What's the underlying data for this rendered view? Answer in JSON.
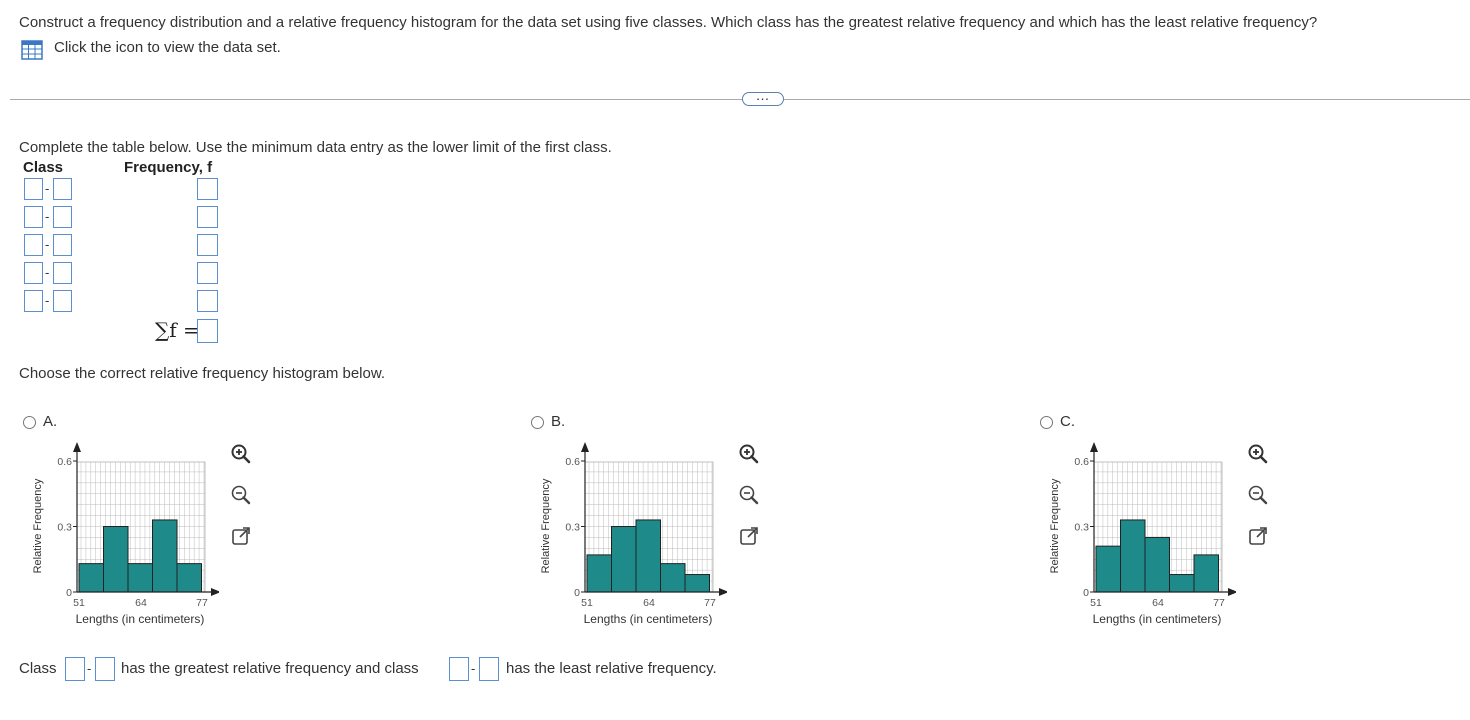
{
  "question": {
    "text": "Construct a frequency distribution and a relative frequency histogram for the data set using five classes. Which class has the greatest relative frequency and which has the least relative frequency?",
    "dataset_link": "Click the icon to view the data set."
  },
  "more_button": "…",
  "part1": {
    "instruction": "Complete the table below. Use the minimum data entry as the lower limit of the first class.",
    "col_class": "Class",
    "col_freq": "Frequency, f",
    "sum_label": "∑f ="
  },
  "part2": {
    "instruction": "Choose the correct relative frequency histogram below."
  },
  "options": [
    {
      "label": "A.",
      "bars": [
        0.13,
        0.3,
        0.13,
        0.33,
        0.13
      ]
    },
    {
      "label": "B.",
      "bars": [
        0.17,
        0.3,
        0.33,
        0.13,
        0.08
      ]
    },
    {
      "label": "C.",
      "bars": [
        0.21,
        0.33,
        0.25,
        0.08,
        0.17
      ]
    }
  ],
  "chart_data": {
    "type": "bar",
    "xlabel": "Lengths (in centimeters)",
    "ylabel": "Relative Frequency",
    "xticks": [
      "51",
      "64",
      "77"
    ],
    "yticks": [
      "0",
      "0.3",
      "0.6"
    ],
    "ylim": [
      0,
      0.6
    ],
    "bar_color": "#1e8a8a"
  },
  "answer": {
    "prefix": "Class",
    "mid": "has the greatest relative frequency and class",
    "suffix": "has the least relative frequency."
  }
}
